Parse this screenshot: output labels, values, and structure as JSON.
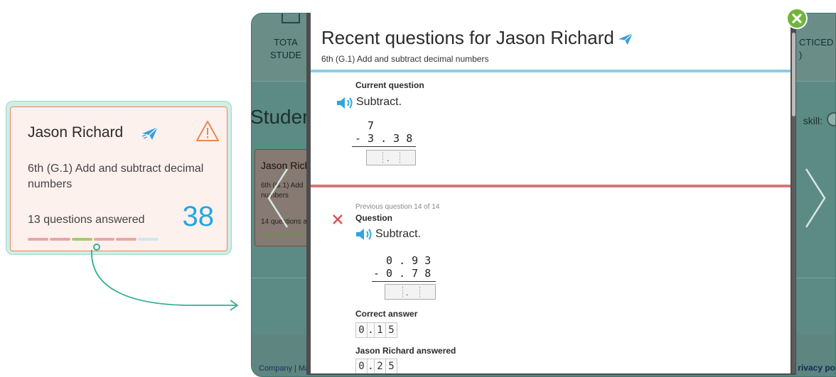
{
  "card": {
    "student_name": "Jason Richard",
    "skill": "6th (G.1)  Add and subtract decimal numbers",
    "questions_answered": "13 questions answered",
    "score": "38",
    "bar_colors": [
      "#e8a5a9",
      "#e8a5a9",
      "#a9c96a",
      "#e8a5a9",
      "#e8a5a9",
      "#cde8ea"
    ],
    "accent_color": "#e98853",
    "score_color": "#23a7e0"
  },
  "background_app": {
    "stats": [
      {
        "label": "TOTA\nSTUDE",
        "icon": "students-icon"
      },
      {
        "label": "CTICED\n)",
        "icon": "pencil-icon"
      }
    ],
    "section_title": "Student",
    "skill_filter_label": "skill:",
    "student_card": {
      "name": "Jason Rich",
      "skill": "6th (G.1) Add\nnumbers",
      "answered": "14 questions a"
    },
    "footer_links": "Company  |  Ma",
    "footer_privacy": "rivacy po"
  },
  "modal": {
    "title": "Recent questions for Jason Richard",
    "subtitle": "6th (G.1)  Add and subtract decimal numbers",
    "current": {
      "label": "Current question",
      "prompt": "Subtract.",
      "problem_lines": [
        "  7",
        "- 3 . 3 8"
      ]
    },
    "previous": {
      "counter": "Previous question 14 of 14",
      "label": "Question",
      "prompt": "Subtract.",
      "problem_lines": [
        "  0 . 9 3",
        "- 0 . 7 8"
      ],
      "correct_answer_label": "Correct answer",
      "correct_answer_digits": [
        "0",
        ".",
        "1",
        "5"
      ],
      "student_answer_label": "Jason Richard answered",
      "student_answer_digits": [
        "0",
        ".",
        "2",
        "5"
      ]
    }
  }
}
